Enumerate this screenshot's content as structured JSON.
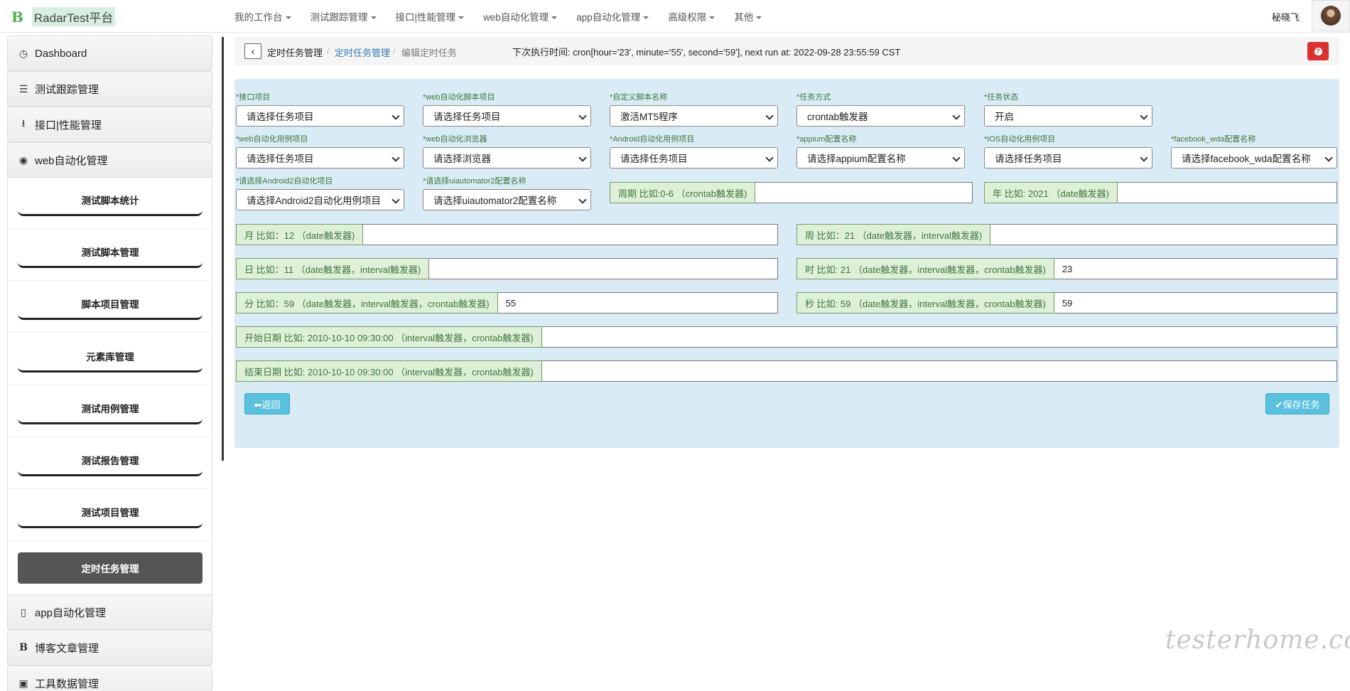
{
  "brand": {
    "logo_letter": "B",
    "name": "RadarTest平台"
  },
  "nav": {
    "items": [
      "我的工作台",
      "测试跟踪管理",
      "接口|性能管理",
      "web自动化管理",
      "app自动化管理",
      "高级权限",
      "其他"
    ],
    "user_name": "秘晓飞"
  },
  "sidebar": {
    "groups_top": [
      "Dashboard",
      "测试跟踪管理",
      "接口|性能管理",
      "web自动化管理"
    ],
    "sub_items": [
      "测试脚本统计",
      "测试脚本管理",
      "脚本项目管理",
      "元素库管理",
      "测试用例管理",
      "测试报告管理",
      "测试项目管理",
      "定时任务管理"
    ],
    "active_sub": "定时任务管理",
    "groups_bottom": [
      "app自动化管理",
      "博客文章管理",
      "工具数据管理"
    ],
    "icons": [
      "dashboard-icon",
      "list-icon",
      "download-icon",
      "globe-icon",
      "mobile-icon",
      "blog-icon",
      "briefcase-icon"
    ]
  },
  "breadcrumb": {
    "back": "‹",
    "items": [
      "定时任务管理",
      "定时任务管理",
      "编辑定时任务"
    ],
    "next_run": "下次执行时间: cron[hour='23', minute='55', second='59'], next run at: 2022-09-28 23:55:59 CST",
    "help": "?"
  },
  "form": {
    "selects": [
      {
        "label": "*接口项目",
        "value": "请选择任务项目"
      },
      {
        "label": "*web自动化脚本项目",
        "value": "请选择任务项目"
      },
      {
        "label": "*自定义脚本名称",
        "value": "激活MT5程序"
      },
      {
        "label": "*任务方式",
        "value": "crontab触发器"
      },
      {
        "label": "*任务状态",
        "value": "开启"
      },
      {
        "label": "*web自动化用例项目",
        "value": "请选择任务项目"
      },
      {
        "label": "*web自动化浏览器",
        "value": "请选择浏览器"
      },
      {
        "label": "*Android自动化用例项目",
        "value": "请选择任务项目"
      },
      {
        "label": "*appium配置名称",
        "value": "请选择appium配置名称"
      },
      {
        "label": "*IOS自动化用例项目",
        "value": "请选择任务项目"
      },
      {
        "label": "*facebook_wda配置名称",
        "value": "请选择facebook_wda配置名称"
      },
      {
        "label": "*请选择Android2自动化项目",
        "value": "请选择Android2自动化用例项目"
      },
      {
        "label": "*请选择uiautomator2配置名称",
        "value": "请选择uiautomator2配置名称"
      }
    ],
    "inputs": [
      {
        "label": "周期 比如:0-6 （crontab触发器)",
        "value": ""
      },
      {
        "label": "年 比如: 2021 （date触发器)",
        "value": ""
      },
      {
        "label": "月 比如：12 （date触发器)",
        "value": ""
      },
      {
        "label": "周 比如：21 （date触发器，interval触发器)",
        "value": ""
      },
      {
        "label": "日 比如：11 （date触发器，interval触发器)",
        "value": ""
      },
      {
        "label": "时 比如: 21 （date触发器，interval触发器，crontab触发器)",
        "value": "23"
      },
      {
        "label": "分 比如：59 （date触发器，interval触发器，crontab触发器)",
        "value": "55"
      },
      {
        "label": "秒 比如: 59 （date触发器，interval触发器，crontab触发器)",
        "value": "59"
      },
      {
        "label": "开始日期 比如: 2010-10-10 09:30:00 （interval触发器，crontab触发器)",
        "value": ""
      },
      {
        "label": "结束日期 比如: 2010-10-10 09:30:00 （interval触发器，crontab触发器)",
        "value": ""
      }
    ],
    "back_button": "⬅返回",
    "save_button": "✔保存任务"
  },
  "watermark": "testerhome.com",
  "colors": {
    "panel_bg": "#d9ecf6",
    "addon_bg": "#dff0d8",
    "addon_text": "#3c763d",
    "button": "#5bc0de",
    "active_sidebar": "#555555",
    "help_button": "#d9322e"
  }
}
